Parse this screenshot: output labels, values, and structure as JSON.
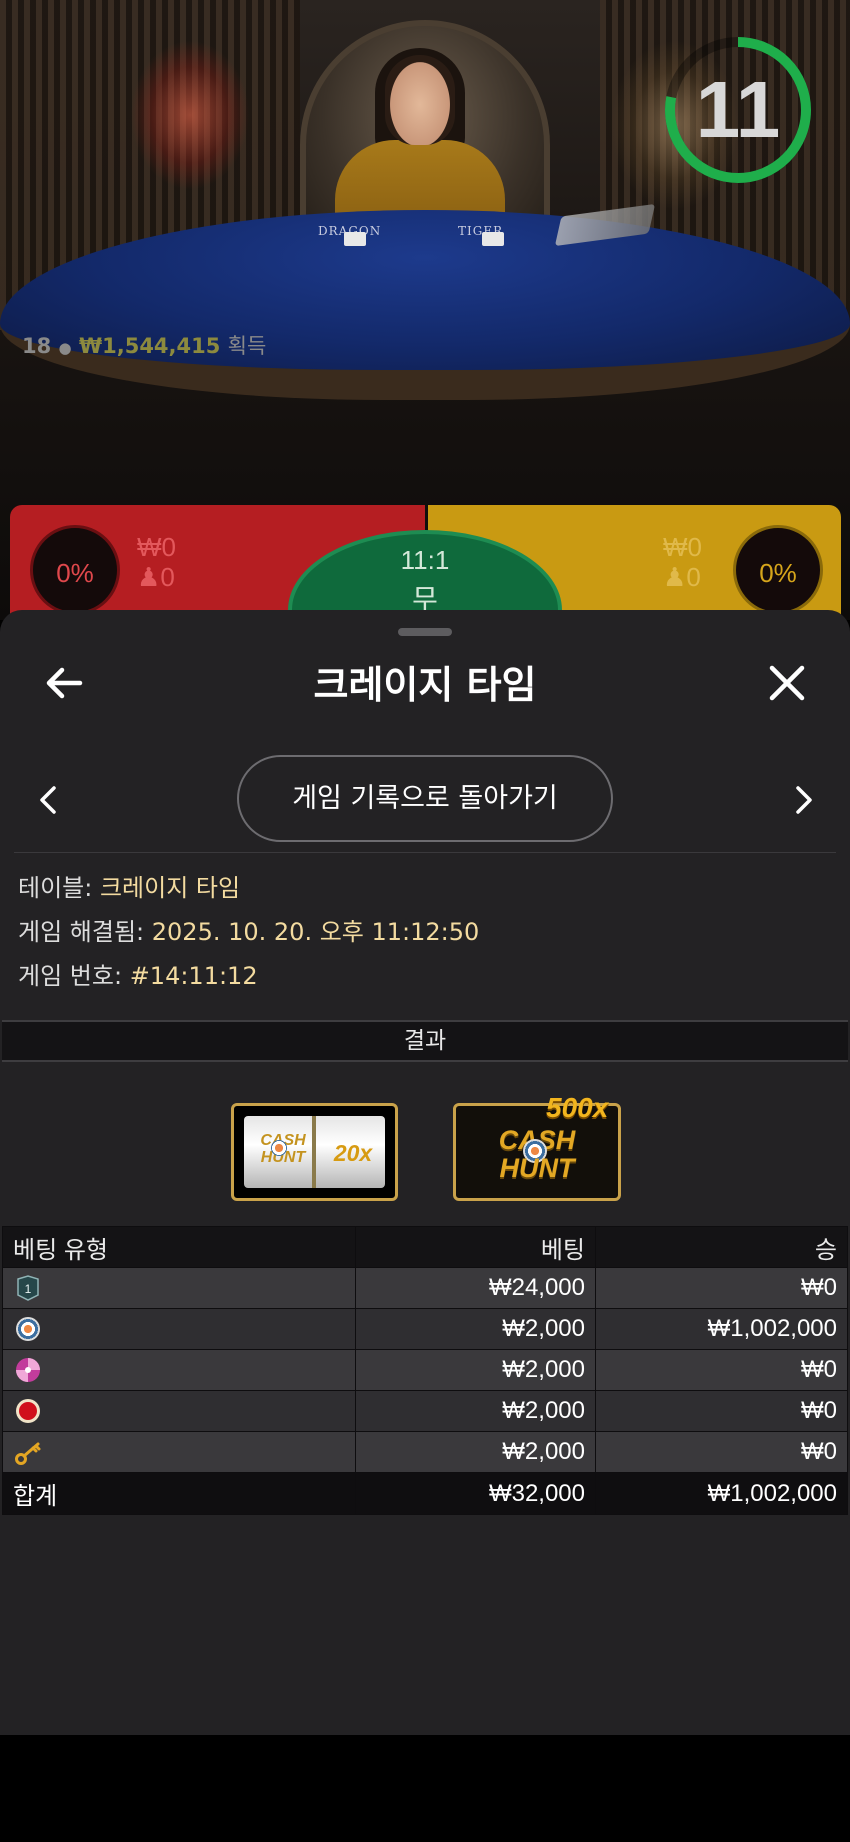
{
  "video": {
    "countdown": "11",
    "countdown_fraction": 0.78,
    "felt_left": "DRAGON",
    "felt_right": "TIGER",
    "players": "18",
    "winnings": "₩1,544,415",
    "winnings_suffix": "획득"
  },
  "bet_spots": {
    "dragon": {
      "percent": "0%",
      "amount": "₩0",
      "players": "0"
    },
    "tie": {
      "odds": "11:1",
      "label": "무"
    },
    "tiger": {
      "percent": "0%",
      "amount": "₩0",
      "players": "0"
    }
  },
  "sheet": {
    "title": "크레이지 타임",
    "back_to_history": "게임 기록으로 돌아가기",
    "info": {
      "table_label": "테이블:",
      "table_value": "크레이지 타임",
      "resolved_label": "게임 해결됨:",
      "resolved_value": "2025. 10. 20. 오후 11:12:50",
      "round_label": "게임 번호:",
      "round_value": "#14:11:12"
    },
    "result_header": "결과",
    "result_tiles": {
      "slot": {
        "game": "CASH HUNT",
        "word1": "CASH",
        "word2": "HUNT",
        "multiplier": "20x"
      },
      "wheel": {
        "game": "CASH HUNT",
        "word1": "CASH",
        "word2": "HUNT",
        "multiplier": "500x"
      }
    },
    "bets_table": {
      "headers": [
        "베팅 유형",
        "베팅",
        "승"
      ],
      "rows": [
        {
          "icon": "number-1-icon",
          "label": "1",
          "bet": "₩24,000",
          "win": "₩0"
        },
        {
          "icon": "cash-hunt-target-icon",
          "bet": "₩2,000",
          "win": "₩1,002,000"
        },
        {
          "icon": "pachinko-icon",
          "bet": "₩2,000",
          "win": "₩0"
        },
        {
          "icon": "coin-flip-icon",
          "bet": "₩2,000",
          "win": "₩0"
        },
        {
          "icon": "crazy-time-key-icon",
          "bet": "₩2,000",
          "win": "₩0"
        }
      ],
      "total": {
        "label": "합계",
        "bet": "₩32,000",
        "win": "₩1,002,000"
      }
    }
  },
  "colors": {
    "dragon_red": "#b51e22",
    "tiger_yellow": "#c99a12",
    "tie_green": "#0f6a3c",
    "timer_green": "#1fae4b",
    "value_gold": "#f3dba0"
  }
}
